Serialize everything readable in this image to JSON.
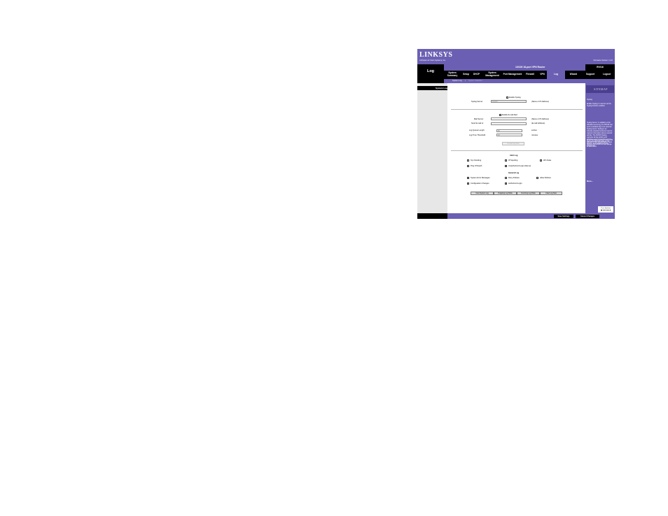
{
  "brand": {
    "logo": "LINKSYS",
    "subtitle": "A Division of Cisco Systems, Inc.",
    "firmware": "Firmware Version: 1.3.0",
    "accent": "#6b5fb3",
    "dark": "#000000"
  },
  "header": {
    "section": "Log",
    "product": "10/100 16-port VPN Router",
    "model": "RV016"
  },
  "tabs": [
    {
      "label": "System Summary",
      "active": false
    },
    {
      "label": "Setup",
      "active": false
    },
    {
      "label": "DHCP",
      "active": false
    },
    {
      "label": "System Management",
      "active": false
    },
    {
      "label": "Port Management",
      "active": false
    },
    {
      "label": "Firewall",
      "active": false
    },
    {
      "label": "VPN",
      "active": false
    },
    {
      "label": "Log",
      "active": true
    },
    {
      "label": "Wizard",
      "active": false
    },
    {
      "label": "Support",
      "active": false
    },
    {
      "label": "Logout",
      "active": false
    }
  ],
  "subtabs": [
    {
      "label": "System Log"
    },
    {
      "label": "|"
    },
    {
      "label": "System Statistics"
    }
  ],
  "sections": {
    "system_log": "System Log",
    "syslog": "Syslog",
    "email": "E-mail",
    "log_setting": "Log Setting"
  },
  "syslog": {
    "enable_label": "Enable Syslog",
    "enable_checked": false,
    "server_label": "Syslog Server:",
    "server_value": "0.0.0.0",
    "server_hint": "(Name or IP Address)"
  },
  "email": {
    "enable_label": "Enable E-mail Alert",
    "enable_checked": false,
    "mail_server_label": "Mail Server:",
    "mail_server_value": "",
    "mail_server_hint": "(Name or IP Address)",
    "send_to_label": "Send E-mail to:",
    "send_to_value": "",
    "send_to_hint": "(E-mail Address)",
    "queue_label": "Log Queue Length:",
    "queue_value": "50",
    "queue_unit": "entries",
    "threshold_label": "Log Time Threshold:",
    "threshold_value": "10",
    "threshold_unit": "minutes",
    "email_now": "E-mail Log Now"
  },
  "log_setting": {
    "alert_title": "Alert Log",
    "alert_items": [
      {
        "label": "Syn Flooding",
        "checked": false
      },
      {
        "label": "IP Spoofing",
        "checked": false
      },
      {
        "label": "Win Nuke",
        "checked": false
      },
      {
        "label": "Ping Of Death",
        "checked": false
      },
      {
        "label": "Unauthorized Login Attempt",
        "checked": true
      }
    ],
    "general_title": "General Log",
    "general_items": [
      {
        "label": "System Error Messages",
        "checked": true
      },
      {
        "label": "Deny Policies",
        "checked": false
      },
      {
        "label": "Allow Policies",
        "checked": false
      },
      {
        "label": "Configuration Changes",
        "checked": true
      },
      {
        "label": "Authorized Login",
        "checked": true
      }
    ],
    "buttons": [
      "View System Log",
      "Outgoing Log Table",
      "Incoming Log Table",
      "Clear Log Now"
    ]
  },
  "help": {
    "sitemap": "SITEMAP",
    "title": "Syslog",
    "p1": "Enable Syslog: Is used to set the Syslog function enabled.",
    "p2": "Syslog Server: In addition to the standard event log, the RV016 can send a detailed log to an external Syslog server. Syslog is an industry-standard protocol used to capture information about network activity. The RV016 Syslog captures all log activity and includes every connection source and destination IP address, IP service, and number of bytes transferred.",
    "p3": "Enter the Syslog server name or IP address in the Syslog Server field. Reboot the RV016 for the change to take effect.",
    "more": "More...",
    "cisco": "Cisco Systems"
  },
  "footer": {
    "save": "Save Settings",
    "cancel": "Cancel Changes"
  }
}
